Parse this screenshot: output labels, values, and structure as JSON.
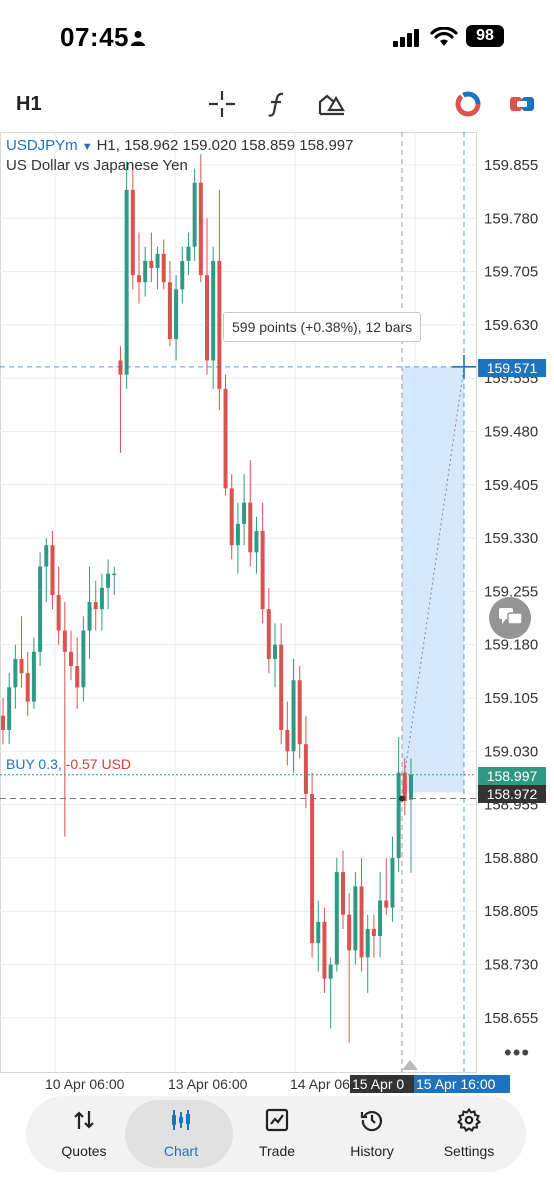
{
  "status_bar": {
    "time": "07:45",
    "battery": "98"
  },
  "toolbar": {
    "timeframe": "H1"
  },
  "symbol": {
    "name": "USDJPYm",
    "summary": "H1, 158.962 159.020 158.859 158.997",
    "description": "US Dollar vs Japanese Yen"
  },
  "measure_tooltip": "599 points (+0.38%), 12 bars",
  "position": {
    "label": "BUY 0.3,",
    "pl": "-0.57 USD"
  },
  "price_tags": {
    "cursor": "159.571",
    "bid": "158.997",
    "entry": "158.972"
  },
  "colors": {
    "bull": "#2e9a84",
    "bear": "#d9534f",
    "accent": "#1e73be",
    "measure_fill": "#cfe4fb"
  },
  "chart_data": {
    "type": "candlestick",
    "title": "",
    "symbol": "USDJPYm",
    "timeframe": "H1",
    "ohlc_header": {
      "open": 158.962,
      "high": 159.02,
      "low": 158.859,
      "close": 158.997
    },
    "y_ticks": [
      "159.855",
      "159.780",
      "159.705",
      "159.630",
      "159.555",
      "159.480",
      "159.405",
      "159.330",
      "159.255",
      "159.180",
      "159.105",
      "159.030",
      "158.955",
      "158.880",
      "158.805",
      "158.730",
      "158.655"
    ],
    "x_ticks": [
      "10 Apr 06:00",
      "13 Apr 06:00",
      "14 Apr 06:00",
      "15 Apr 0",
      "15 Apr 16:00"
    ],
    "ylim": [
      158.6,
      159.9
    ],
    "candles": [
      [
        159.08,
        159.105,
        159.04,
        159.06
      ],
      [
        159.06,
        159.14,
        159.04,
        159.12
      ],
      [
        159.12,
        159.18,
        159.09,
        159.16
      ],
      [
        159.16,
        159.22,
        159.12,
        159.14
      ],
      [
        159.14,
        159.17,
        159.08,
        159.1
      ],
      [
        159.1,
        159.19,
        159.09,
        159.17
      ],
      [
        159.17,
        159.31,
        159.15,
        159.29
      ],
      [
        159.29,
        159.33,
        159.24,
        159.32
      ],
      [
        159.32,
        159.34,
        159.23,
        159.25
      ],
      [
        159.25,
        159.29,
        159.18,
        159.2
      ],
      [
        159.2,
        159.24,
        158.91,
        159.17
      ],
      [
        159.17,
        159.2,
        159.13,
        159.15
      ],
      [
        159.15,
        159.19,
        159.09,
        159.12
      ],
      [
        159.12,
        159.22,
        159.1,
        159.2
      ],
      [
        159.2,
        159.29,
        159.16,
        159.24
      ],
      [
        159.24,
        159.27,
        159.2,
        159.23
      ],
      [
        159.23,
        159.28,
        159.2,
        159.26
      ],
      [
        159.26,
        159.3,
        159.23,
        159.28
      ],
      [
        159.28,
        159.29,
        159.25,
        159.28
      ],
      [
        159.58,
        159.6,
        159.45,
        159.56
      ],
      [
        159.56,
        159.86,
        159.54,
        159.82
      ],
      [
        159.82,
        159.85,
        159.68,
        159.7
      ],
      [
        159.7,
        159.76,
        159.66,
        159.69
      ],
      [
        159.69,
        159.74,
        159.67,
        159.72
      ],
      [
        159.72,
        159.76,
        159.69,
        159.71
      ],
      [
        159.71,
        159.74,
        159.68,
        159.73
      ],
      [
        159.73,
        159.75,
        159.68,
        159.69
      ],
      [
        159.69,
        159.72,
        159.6,
        159.61
      ],
      [
        159.61,
        159.7,
        159.58,
        159.68
      ],
      [
        159.68,
        159.74,
        159.66,
        159.72
      ],
      [
        159.72,
        159.76,
        159.7,
        159.74
      ],
      [
        159.74,
        159.85,
        159.72,
        159.83
      ],
      [
        159.83,
        159.87,
        159.69,
        159.7
      ],
      [
        159.7,
        159.78,
        159.56,
        159.58
      ],
      [
        159.58,
        159.74,
        159.54,
        159.72
      ],
      [
        159.72,
        159.82,
        159.51,
        159.54
      ],
      [
        159.54,
        159.56,
        159.39,
        159.4
      ],
      [
        159.4,
        159.42,
        159.3,
        159.32
      ],
      [
        159.32,
        159.38,
        159.28,
        159.35
      ],
      [
        159.35,
        159.42,
        159.32,
        159.38
      ],
      [
        159.38,
        159.44,
        159.29,
        159.31
      ],
      [
        159.31,
        159.36,
        159.28,
        159.34
      ],
      [
        159.34,
        159.38,
        159.21,
        159.23
      ],
      [
        159.23,
        159.26,
        159.14,
        159.16
      ],
      [
        159.16,
        159.21,
        159.12,
        159.18
      ],
      [
        159.18,
        159.21,
        159.04,
        159.06
      ],
      [
        159.06,
        159.1,
        159.01,
        159.03
      ],
      [
        159.03,
        159.16,
        159.0,
        159.13
      ],
      [
        159.13,
        159.15,
        159.02,
        159.04
      ],
      [
        159.04,
        159.08,
        158.95,
        158.97
      ],
      [
        158.97,
        159.0,
        158.74,
        158.76
      ],
      [
        158.76,
        158.82,
        158.72,
        158.79
      ],
      [
        158.79,
        158.81,
        158.69,
        158.71
      ],
      [
        158.71,
        158.74,
        158.64,
        158.73
      ],
      [
        158.73,
        158.88,
        158.72,
        158.86
      ],
      [
        158.86,
        158.89,
        158.78,
        158.8
      ],
      [
        158.8,
        158.83,
        158.62,
        158.75
      ],
      [
        158.75,
        158.86,
        158.73,
        158.84
      ],
      [
        158.84,
        158.88,
        158.72,
        158.74
      ],
      [
        158.74,
        158.8,
        158.69,
        158.78
      ],
      [
        158.78,
        158.8,
        158.74,
        158.77
      ],
      [
        158.77,
        158.86,
        158.74,
        158.82
      ],
      [
        158.82,
        158.88,
        158.8,
        158.81
      ],
      [
        158.81,
        158.91,
        158.79,
        158.88
      ],
      [
        158.88,
        159.05,
        158.86,
        159.0
      ],
      [
        159.0,
        159.02,
        158.94,
        158.96
      ],
      [
        158.962,
        159.02,
        158.859,
        158.997
      ]
    ],
    "measurement": {
      "points": 599,
      "percent": "+0.38%",
      "bars": 12,
      "from_price": 158.972,
      "to_price": 159.571
    },
    "grid": true
  },
  "nav": {
    "items": [
      {
        "label": "Quotes",
        "icon": "quotes-icon"
      },
      {
        "label": "Chart",
        "icon": "chart-icon",
        "active": true
      },
      {
        "label": "Trade",
        "icon": "trade-icon"
      },
      {
        "label": "History",
        "icon": "history-icon"
      },
      {
        "label": "Settings",
        "icon": "settings-icon"
      }
    ]
  }
}
